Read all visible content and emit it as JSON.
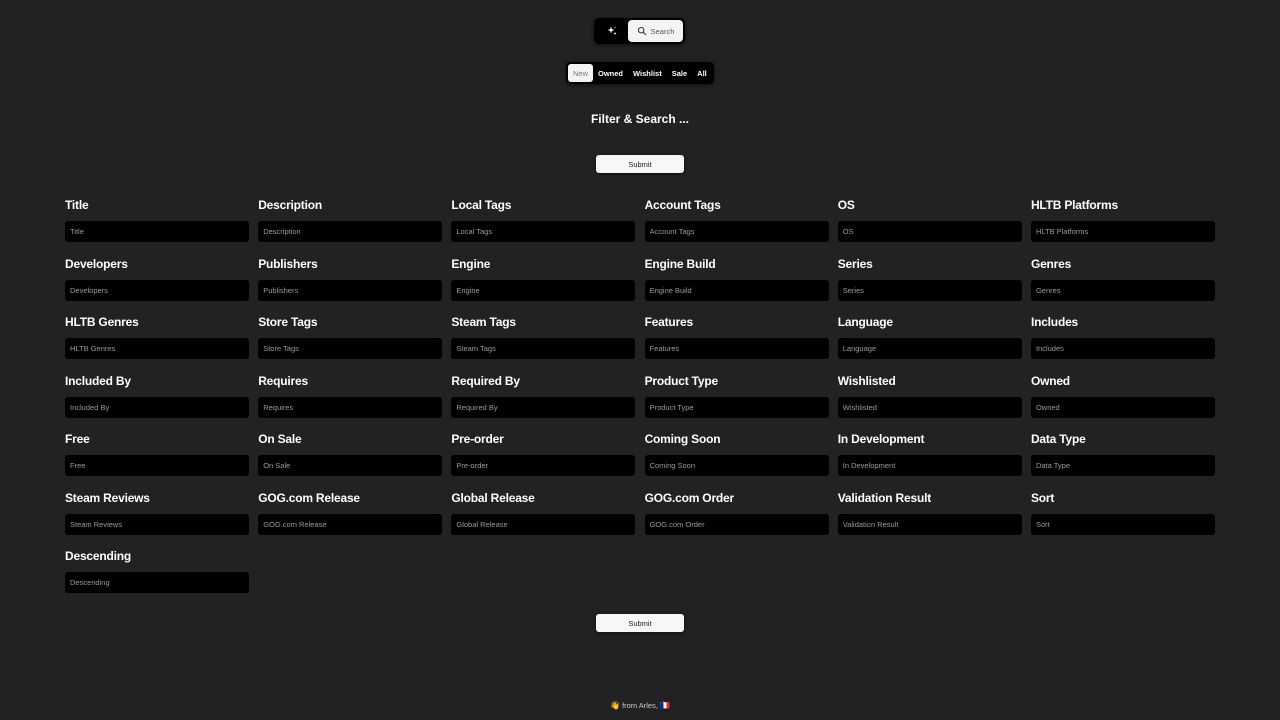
{
  "top_switch": {
    "ai_icon": "sparkle-icon",
    "search_icon": "search-icon",
    "search_label": "Search"
  },
  "tabs": [
    {
      "label": "New",
      "active": true
    },
    {
      "label": "Owned",
      "active": false
    },
    {
      "label": "Wishlist",
      "active": false
    },
    {
      "label": "Sale",
      "active": false
    },
    {
      "label": "All",
      "active": false
    }
  ],
  "heading": "Filter & Search ...",
  "submit_label": "Submit",
  "fields": [
    {
      "label": "Title",
      "placeholder": "Title",
      "value": ""
    },
    {
      "label": "Description",
      "placeholder": "Description",
      "value": ""
    },
    {
      "label": "Local Tags",
      "placeholder": "Local Tags",
      "value": ""
    },
    {
      "label": "Account Tags",
      "placeholder": "Account Tags",
      "value": ""
    },
    {
      "label": "OS",
      "placeholder": "OS",
      "value": ""
    },
    {
      "label": "HLTB Platforms",
      "placeholder": "HLTB Platforms",
      "value": ""
    },
    {
      "label": "Developers",
      "placeholder": "Developers",
      "value": ""
    },
    {
      "label": "Publishers",
      "placeholder": "Publishers",
      "value": ""
    },
    {
      "label": "Engine",
      "placeholder": "Engine",
      "value": ""
    },
    {
      "label": "Engine Build",
      "placeholder": "Engine Build",
      "value": ""
    },
    {
      "label": "Series",
      "placeholder": "Series",
      "value": ""
    },
    {
      "label": "Genres",
      "placeholder": "Genres",
      "value": ""
    },
    {
      "label": "HLTB Genres",
      "placeholder": "HLTB Genres",
      "value": ""
    },
    {
      "label": "Store Tags",
      "placeholder": "Store Tags",
      "value": ""
    },
    {
      "label": "Steam Tags",
      "placeholder": "Steam Tags",
      "value": ""
    },
    {
      "label": "Features",
      "placeholder": "Features",
      "value": ""
    },
    {
      "label": "Language",
      "placeholder": "Language",
      "value": ""
    },
    {
      "label": "Includes",
      "placeholder": "Includes",
      "value": ""
    },
    {
      "label": "Included By",
      "placeholder": "Included By",
      "value": ""
    },
    {
      "label": "Requires",
      "placeholder": "Requires",
      "value": ""
    },
    {
      "label": "Required By",
      "placeholder": "Required By",
      "value": ""
    },
    {
      "label": "Product Type",
      "placeholder": "Product Type",
      "value": ""
    },
    {
      "label": "Wishlisted",
      "placeholder": "Wishlisted",
      "value": ""
    },
    {
      "label": "Owned",
      "placeholder": "Owned",
      "value": ""
    },
    {
      "label": "Free",
      "placeholder": "Free",
      "value": ""
    },
    {
      "label": "On Sale",
      "placeholder": "On Sale",
      "value": ""
    },
    {
      "label": "Pre-order",
      "placeholder": "Pre-order",
      "value": ""
    },
    {
      "label": "Coming Soon",
      "placeholder": "Coming Soon",
      "value": ""
    },
    {
      "label": "In Development",
      "placeholder": "In Development",
      "value": ""
    },
    {
      "label": "Data Type",
      "placeholder": "Data Type",
      "value": ""
    },
    {
      "label": "Steam Reviews",
      "placeholder": "Steam Reviews",
      "value": ""
    },
    {
      "label": "GOG.com Release",
      "placeholder": "GOG.com Release",
      "value": ""
    },
    {
      "label": "Global Release",
      "placeholder": "Global Release",
      "value": ""
    },
    {
      "label": "GOG.com Order",
      "placeholder": "GOG.com Order",
      "value": ""
    },
    {
      "label": "Validation Result",
      "placeholder": "Validation Result",
      "value": ""
    },
    {
      "label": "Sort",
      "placeholder": "Sort",
      "value": ""
    },
    {
      "label": "Descending",
      "placeholder": "Descending",
      "value": ""
    }
  ],
  "footer": {
    "wave_emoji": "👋",
    "text": "from Arles,",
    "flag_emoji": "🇫🇷"
  },
  "colors": {
    "background": "#222222",
    "input_background": "#000000",
    "button_background": "#f7f7f7",
    "text": "#ffffff",
    "placeholder": "#9a9a9a"
  }
}
